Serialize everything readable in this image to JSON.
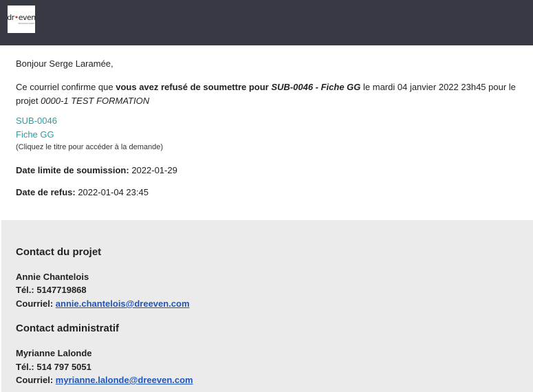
{
  "header": {
    "logo_text_pre": "dr",
    "logo_text_dot": "•",
    "logo_text_post": "even",
    "logo_subtext": "TECHNOLOGIES"
  },
  "email": {
    "greeting": "Bonjour Serge Laramée,",
    "confirm_prefix": "Ce courriel confirme que ",
    "confirm_bold": "vous avez refusé de soumettre pour ",
    "confirm_item": "SUB-0046 - Fiche GG",
    "confirm_mid": " le mardi 04 janvier 2022 23h45 pour le projet ",
    "confirm_project": "0000-1 TEST FORMATION",
    "link_code": "SUB-0046",
    "link_title": "Fiche GG",
    "link_hint": "(Cliquez le titre pour accéder à la demande)",
    "deadline_label": "Date limite de soumission:",
    "deadline_value": " 2022-01-29",
    "refusal_label": "Date de refus:",
    "refusal_value": " 2022-01-04 23:45"
  },
  "contacts": {
    "project": {
      "title": "Contact du projet",
      "name": "Annie Chantelois",
      "phone_label": "Tél.: ",
      "phone": "5147719868",
      "email_label": "Courriel: ",
      "email": "annie.chantelois@dreeven.com"
    },
    "admin": {
      "title": "Contact administratif",
      "name": "Myrianne Lalonde",
      "phone_label": "Tél.: ",
      "phone": "514 797 5051",
      "email_label": "Courriel: ",
      "email": "myrianne.lalonde@dreeven.com"
    }
  },
  "colors": {
    "header_bg": "#373a43",
    "link": "#2a9ca3",
    "mail_link": "#2255b8",
    "footer_bg": "#ebebeb"
  }
}
